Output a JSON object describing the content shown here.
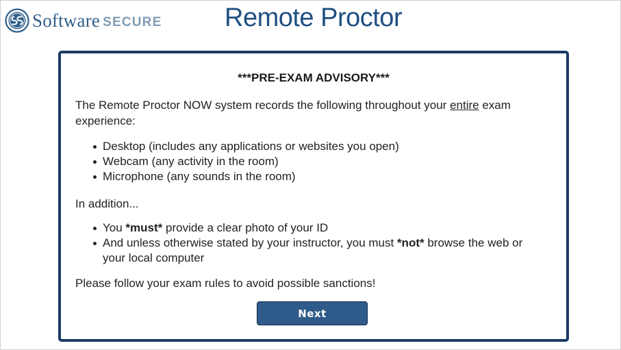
{
  "header": {
    "logo": {
      "icon": "software-secure-logo-icon",
      "word_software": "Software",
      "word_secure": "SECURE"
    },
    "app_title": "Remote Proctor"
  },
  "advisory": {
    "title": "***PRE-EXAM ADVISORY***",
    "intro": {
      "before": "The Remote Proctor NOW system records the following throughout your ",
      "underlined": "entire",
      "after": " exam experience:"
    },
    "recorded_items": [
      "Desktop (includes any applications or websites you open)",
      "Webcam (any activity in the room)",
      "Microphone (any sounds in the room)"
    ],
    "in_addition": "In addition...",
    "rules": [
      {
        "before": "You ",
        "bold": "*must*",
        "after": " provide a clear photo of your ID"
      },
      {
        "before": "And unless otherwise stated by your instructor, you must ",
        "bold": "*not*",
        "after": " browse the web or your local computer"
      }
    ],
    "closing": "Please follow your exam rules to avoid possible sanctions!",
    "next_label": "Next"
  },
  "colors": {
    "brand_blue": "#1f4f82",
    "card_border": "#1b3a66",
    "button_bg": "#2f5b8a",
    "logo_secure": "#7f9bb3"
  }
}
